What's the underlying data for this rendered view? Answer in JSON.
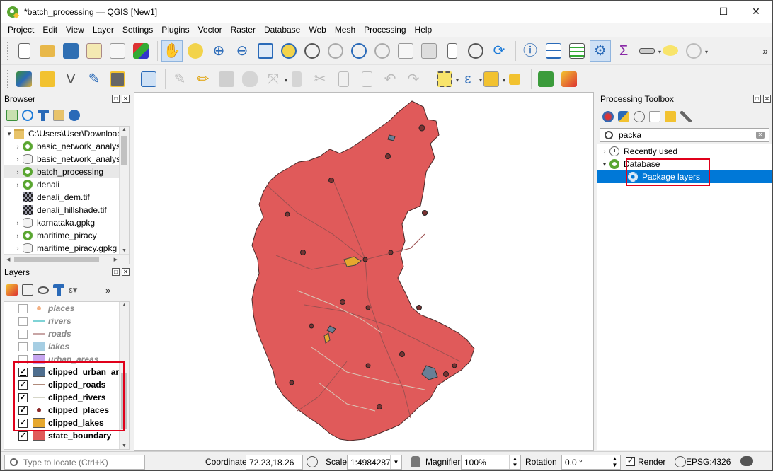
{
  "window": {
    "title": "*batch_processing — QGIS [New1]",
    "controls": [
      "–",
      "☐",
      "✕"
    ]
  },
  "menu": [
    "Project",
    "Edit",
    "View",
    "Layer",
    "Settings",
    "Plugins",
    "Vector",
    "Raster",
    "Database",
    "Web",
    "Mesh",
    "Processing",
    "Help"
  ],
  "browser": {
    "title": "Browser",
    "items": [
      {
        "label": "C:\\Users\\User\\Downloads",
        "icon": "folder-icon",
        "expand": "▾"
      },
      {
        "label": "basic_network_analysis",
        "icon": "qgis-project-icon",
        "expand": "›"
      },
      {
        "label": "basic_network_analysis",
        "icon": "geopackage-icon",
        "expand": "›"
      },
      {
        "label": "batch_processing",
        "icon": "qgis-project-icon",
        "expand": "›"
      },
      {
        "label": "denali",
        "icon": "qgis-project-icon",
        "expand": "›"
      },
      {
        "label": "denali_dem.tif",
        "icon": "raster-icon",
        "expand": ""
      },
      {
        "label": "denali_hillshade.tif",
        "icon": "raster-icon",
        "expand": ""
      },
      {
        "label": "karnataka.gpkg",
        "icon": "geopackage-icon",
        "expand": "›"
      },
      {
        "label": "maritime_piracy",
        "icon": "qgis-project-icon",
        "expand": "›"
      },
      {
        "label": "maritime_piracy.gpkg",
        "icon": "geopackage-icon",
        "expand": "›"
      }
    ]
  },
  "layers": {
    "title": "Layers",
    "items": [
      {
        "label": "places",
        "checked": false,
        "symbol": "dot",
        "color": "#f4b183"
      },
      {
        "label": "rivers",
        "checked": false,
        "symbol": "line",
        "color": "#7fd3d6"
      },
      {
        "label": "roads",
        "checked": false,
        "symbol": "line",
        "color": "#c8a5a5"
      },
      {
        "label": "lakes",
        "checked": false,
        "symbol": "fill",
        "color": "#a6cee3"
      },
      {
        "label": "urban_areas",
        "checked": false,
        "symbol": "fill",
        "color": "#c7a6f0"
      },
      {
        "label": "clipped_urban_areas",
        "checked": true,
        "symbol": "fill",
        "color": "#4f6f8f"
      },
      {
        "label": "clipped_roads",
        "checked": true,
        "symbol": "line",
        "color": "#b08a7a"
      },
      {
        "label": "clipped_rivers",
        "checked": true,
        "symbol": "line",
        "color": "#d6d6c8"
      },
      {
        "label": "clipped_places",
        "checked": true,
        "symbol": "dot",
        "color": "#8b2a2a"
      },
      {
        "label": "clipped_lakes",
        "checked": true,
        "symbol": "fill",
        "color": "#e6a82e"
      },
      {
        "label": "state_boundary",
        "checked": true,
        "symbol": "fill",
        "color": "#e05a5a"
      }
    ]
  },
  "toolbox": {
    "title": "Processing Toolbox",
    "search_value": "packa",
    "tree": [
      {
        "label": "Recently used",
        "icon": "clock-icon",
        "expand": "›"
      },
      {
        "label": "Database",
        "icon": "qgis-icon",
        "expand": "▾"
      },
      {
        "label": "Package layers",
        "icon": "gear-icon",
        "expand": ""
      }
    ]
  },
  "status": {
    "locate_placeholder": "Type to locate (Ctrl+K)",
    "coordinate_label": "Coordinate",
    "coordinate_value": "72.23,18.26",
    "scale_label": "Scale",
    "scale_value": "1:4984287",
    "magnifier_label": "Magnifier",
    "magnifier_value": "100%",
    "rotation_label": "Rotation",
    "rotation_value": "0.0 °",
    "render_label": "Render",
    "crs_label": "EPSG:4326"
  },
  "colors": {
    "state_fill": "#e05a5a",
    "selection": "#0078d7",
    "highlight_box": "#e0001a"
  }
}
